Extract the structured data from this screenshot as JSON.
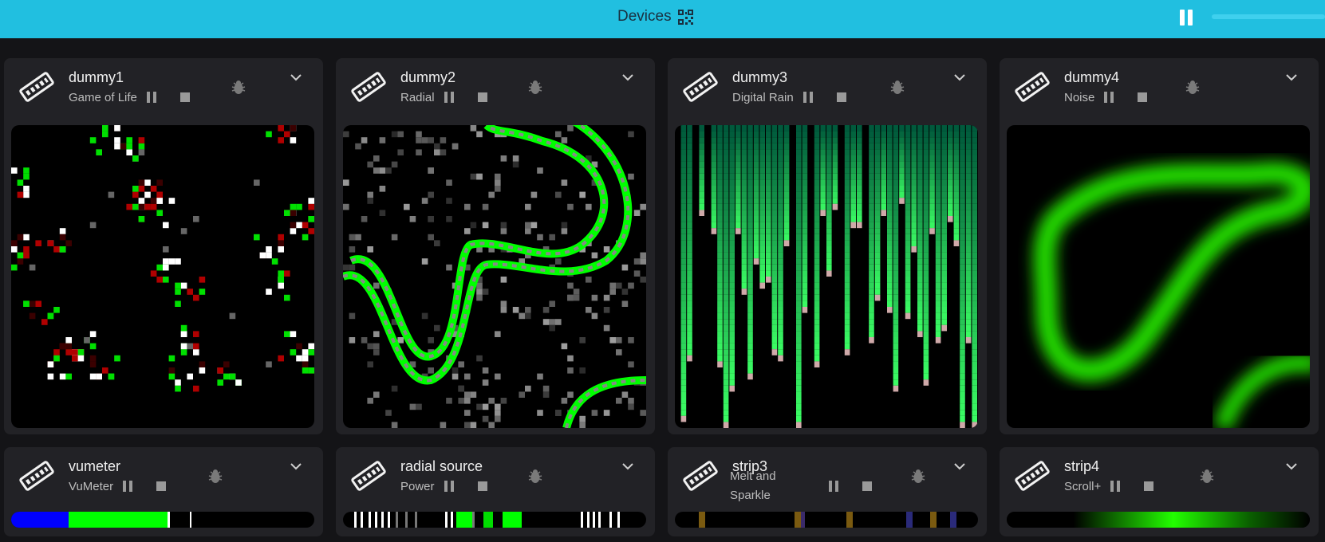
{
  "header": {
    "title": "Devices",
    "qr_icon": "qr-code-icon",
    "pause_icon": "pause-icon"
  },
  "colors": {
    "header_bg": "#21bfe0",
    "card_bg": "#222226",
    "page_bg": "#141417",
    "accent_green": "#00ff00"
  },
  "devices": [
    {
      "name": "dummy1",
      "effect": "Game of Life",
      "kind": "matrix"
    },
    {
      "name": "dummy2",
      "effect": "Radial",
      "kind": "matrix"
    },
    {
      "name": "dummy3",
      "effect": "Digital Rain",
      "kind": "matrix"
    },
    {
      "name": "dummy4",
      "effect": "Noise",
      "kind": "matrix"
    },
    {
      "name": "vumeter",
      "effect": "VuMeter",
      "kind": "strip"
    },
    {
      "name": "radial source",
      "effect": "Power",
      "kind": "strip"
    },
    {
      "name": "strip3",
      "effect": "Melt and Sparkle",
      "kind": "strip"
    },
    {
      "name": "strip4",
      "effect": "Scroll+",
      "kind": "strip"
    }
  ]
}
